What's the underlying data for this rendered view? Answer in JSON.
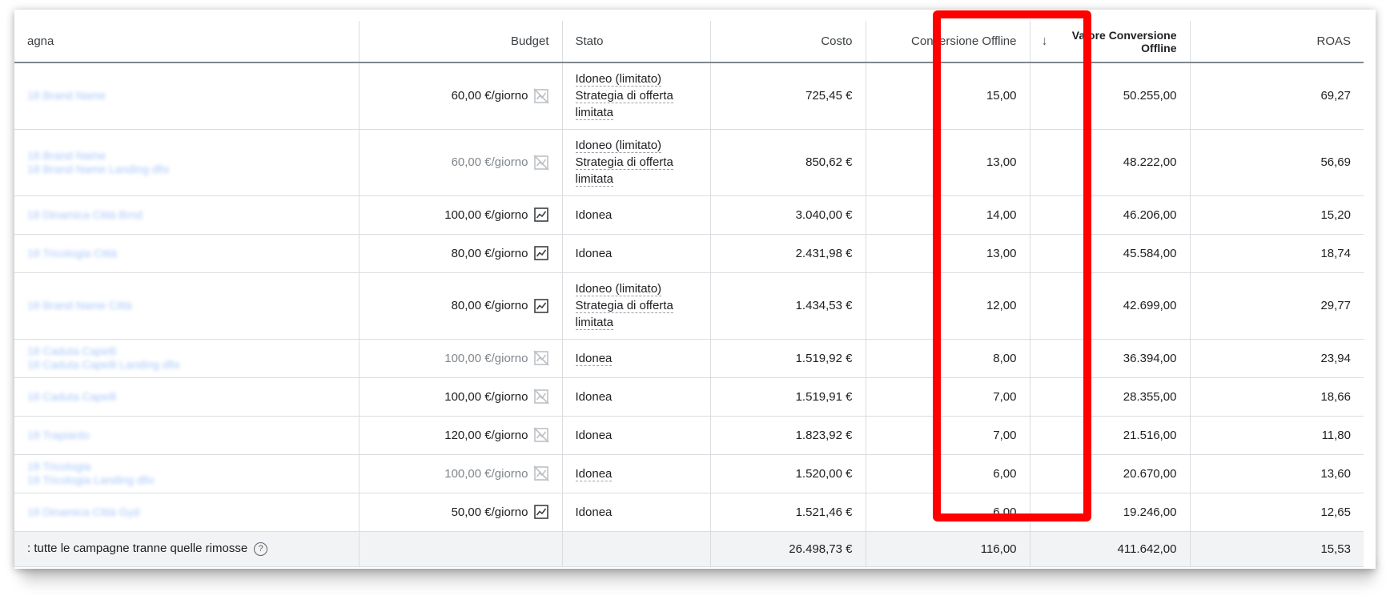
{
  "columns": {
    "campaign": "agna",
    "budget": "Budget",
    "stato": "Stato",
    "costo": "Costo",
    "conversions": "Conversione Offline",
    "value_line1": "Valore Conversione",
    "value_line2": "Offline",
    "roas": "ROAS",
    "sort_icon": "↓"
  },
  "rows": [
    {
      "name1": "18 Brand Name",
      "name2": "",
      "budget": "60,00 €/giorno",
      "budget_icon": "chart-disabled-icon",
      "dim": false,
      "stato": [
        "Idoneo (limitato)",
        "Strategia di offerta",
        "limitata"
      ],
      "costo": "725,45 €",
      "conv": "15,00",
      "value": "50.255,00",
      "roas": "69,27"
    },
    {
      "name1": "18 Brand Name",
      "name2": "18 Brand Name Landing dfix",
      "budget": "60,00 €/giorno",
      "budget_icon": "chart-disabled-icon",
      "dim": true,
      "stato": [
        "Idoneo (limitato)",
        "Strategia di offerta",
        "limitata"
      ],
      "costo": "850,62 €",
      "conv": "13,00",
      "value": "48.222,00",
      "roas": "56,69"
    },
    {
      "name1": "18 Dinamica Città Brnd",
      "name2": "",
      "budget": "100,00 €/giorno",
      "budget_icon": "chart-icon",
      "dim": false,
      "stato": [
        "Idonea"
      ],
      "costo": "3.040,00 €",
      "conv": "14,00",
      "value": "46.206,00",
      "roas": "15,20"
    },
    {
      "name1": "18 Tricologia Città",
      "name2": "",
      "budget": "80,00 €/giorno",
      "budget_icon": "chart-icon",
      "dim": false,
      "stato": [
        "Idonea"
      ],
      "costo": "2.431,98 €",
      "conv": "13,00",
      "value": "45.584,00",
      "roas": "18,74"
    },
    {
      "name1": "18 Brand Name Città",
      "name2": "",
      "budget": "80,00 €/giorno",
      "budget_icon": "chart-icon",
      "dim": false,
      "stato": [
        "Idoneo (limitato)",
        "Strategia di offerta",
        "limitata"
      ],
      "costo": "1.434,53 €",
      "conv": "12,00",
      "value": "42.699,00",
      "roas": "29,77"
    },
    {
      "name1": "18 Caduta Capelli",
      "name2": "18 Caduta Capelli Landing dfix",
      "budget": "100,00 €/giorno",
      "budget_icon": "chart-disabled-icon",
      "dim": true,
      "stato": [
        "Idonea"
      ],
      "stato_underline": true,
      "costo": "1.519,92 €",
      "conv": "8,00",
      "value": "36.394,00",
      "roas": "23,94"
    },
    {
      "name1": "18 Caduta Capelli",
      "name2": "",
      "budget": "100,00 €/giorno",
      "budget_icon": "chart-disabled-icon",
      "dim": false,
      "stato": [
        "Idonea"
      ],
      "costo": "1.519,91 €",
      "conv": "7,00",
      "value": "28.355,00",
      "roas": "18,66"
    },
    {
      "name1": "18 Trapianto",
      "name2": "",
      "budget": "120,00 €/giorno",
      "budget_icon": "chart-disabled-icon",
      "dim": false,
      "stato": [
        "Idonea"
      ],
      "costo": "1.823,92 €",
      "conv": "7,00",
      "value": "21.516,00",
      "roas": "11,80"
    },
    {
      "name1": "18 Tricologia",
      "name2": "18 Tricologia Landing dfix",
      "budget": "100,00 €/giorno",
      "budget_icon": "chart-disabled-icon",
      "dim": true,
      "stato": [
        "Idonea"
      ],
      "stato_underline": true,
      "costo": "1.520,00 €",
      "conv": "6,00",
      "value": "20.670,00",
      "roas": "13,60"
    },
    {
      "name1": "18 Dinamica Città Gyd",
      "name2": "",
      "budget": "50,00 €/giorno",
      "budget_icon": "chart-icon",
      "dim": false,
      "stato": [
        "Idonea"
      ],
      "costo": "1.521,46 €",
      "conv": "6,00",
      "value": "19.246,00",
      "roas": "12,65"
    }
  ],
  "total": {
    "label": ": tutte le campagne tranne quelle rimosse",
    "help_icon": "?",
    "costo": "26.498,73 €",
    "conv": "116,00",
    "value": "411.642,00",
    "roas": "15,53"
  },
  "highlight_color": "#ff0000"
}
